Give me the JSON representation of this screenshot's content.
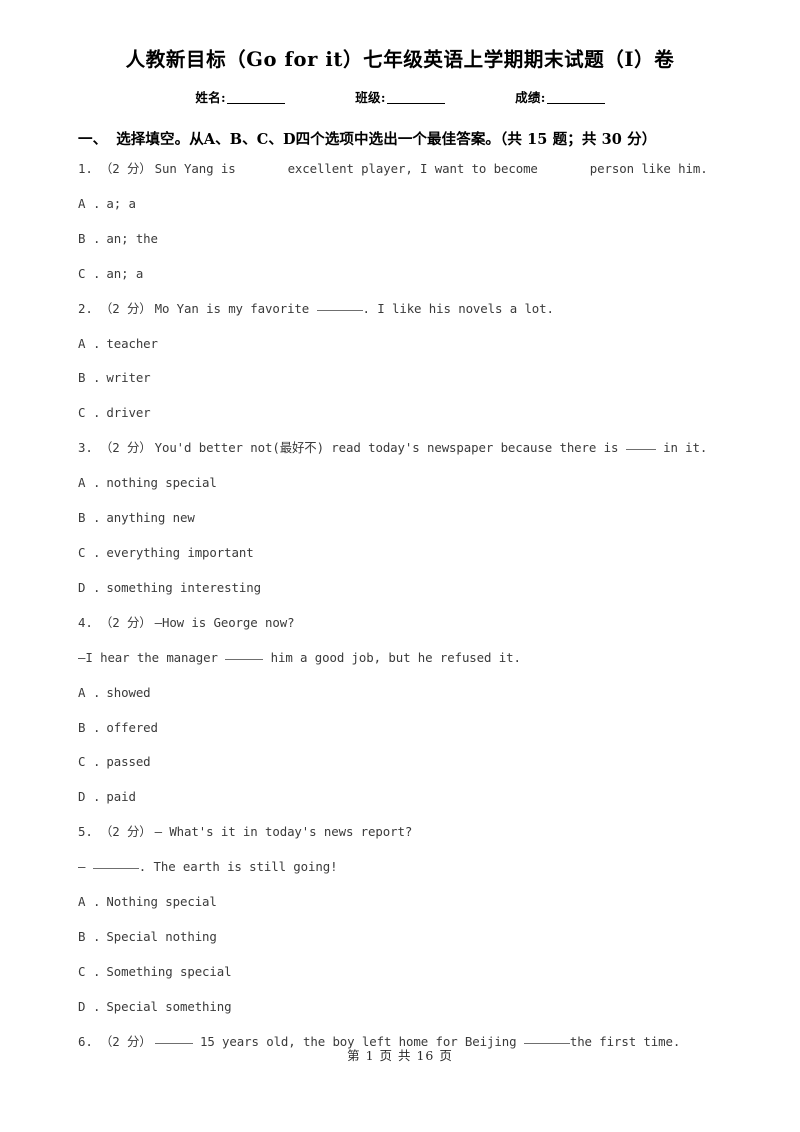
{
  "document": {
    "title": "人教新目标（Go for it）七年级英语上学期期末试题（I）卷"
  },
  "form": {
    "name_label": "姓名:",
    "class_label": "班级:",
    "score_label": "成绩:"
  },
  "section": {
    "number": "一、",
    "title": "选择填空。从A、B、C、D四个选项中选出一个最佳答案。（共 15 题；共 30 分）"
  },
  "questions": [
    {
      "number": "1.",
      "marks": "（2 分）",
      "text_before": "Sun Yang is",
      "text_mid": "excellent player, I want to become",
      "text_after": "person like him.",
      "options": [
        {
          "letter": "A",
          "dot": ".",
          "text": "a; a"
        },
        {
          "letter": "B",
          "dot": ".",
          "text": "an; the"
        },
        {
          "letter": "C",
          "dot": ".",
          "text": "an; a"
        }
      ]
    },
    {
      "number": "2.",
      "marks": "（2 分）",
      "text_before": "Mo Yan is my favorite",
      "text_after": ". I like his novels a lot.",
      "options": [
        {
          "letter": "A",
          "dot": ".",
          "text": "teacher"
        },
        {
          "letter": "B",
          "dot": ".",
          "text": "writer"
        },
        {
          "letter": "C",
          "dot": ".",
          "text": "driver"
        }
      ]
    },
    {
      "number": "3.",
      "marks": "（2 分）",
      "text_before": "You'd better not(最好不) read today's newspaper because there is",
      "text_after": "in it.",
      "options": [
        {
          "letter": "A",
          "dot": ".",
          "text": "nothing special"
        },
        {
          "letter": "B",
          "dot": ".",
          "text": "anything new"
        },
        {
          "letter": "C",
          "dot": ".",
          "text": "everything important"
        },
        {
          "letter": "D",
          "dot": ".",
          "text": "something interesting"
        }
      ]
    },
    {
      "number": "4.",
      "marks": "（2 分）",
      "text_before": "—How is George now?",
      "continuation_before": "—I hear the manager",
      "continuation_after": "him a good job, but he refused it.",
      "options": [
        {
          "letter": "A",
          "dot": ".",
          "text": "showed"
        },
        {
          "letter": "B",
          "dot": ".",
          "text": "offered"
        },
        {
          "letter": "C",
          "dot": ".",
          "text": "passed"
        },
        {
          "letter": "D",
          "dot": ".",
          "text": "paid"
        }
      ]
    },
    {
      "number": "5.",
      "marks": "（2 分）",
      "text_before": "— What's it in today's news report?",
      "continuation_before": "—",
      "continuation_after": ". The earth is still going!",
      "options": [
        {
          "letter": "A",
          "dot": ".",
          "text": "Nothing special"
        },
        {
          "letter": "B",
          "dot": ".",
          "text": "Special nothing"
        },
        {
          "letter": "C",
          "dot": ".",
          "text": "Something special"
        },
        {
          "letter": "D",
          "dot": ".",
          "text": "Special something"
        }
      ]
    },
    {
      "number": "6.",
      "marks": "（2 分）",
      "text_mid": "15 years old, the boy left home for Beijing",
      "text_after": "the first time.",
      "options": []
    }
  ],
  "footer": {
    "text": "第 1 页 共 16 页"
  }
}
